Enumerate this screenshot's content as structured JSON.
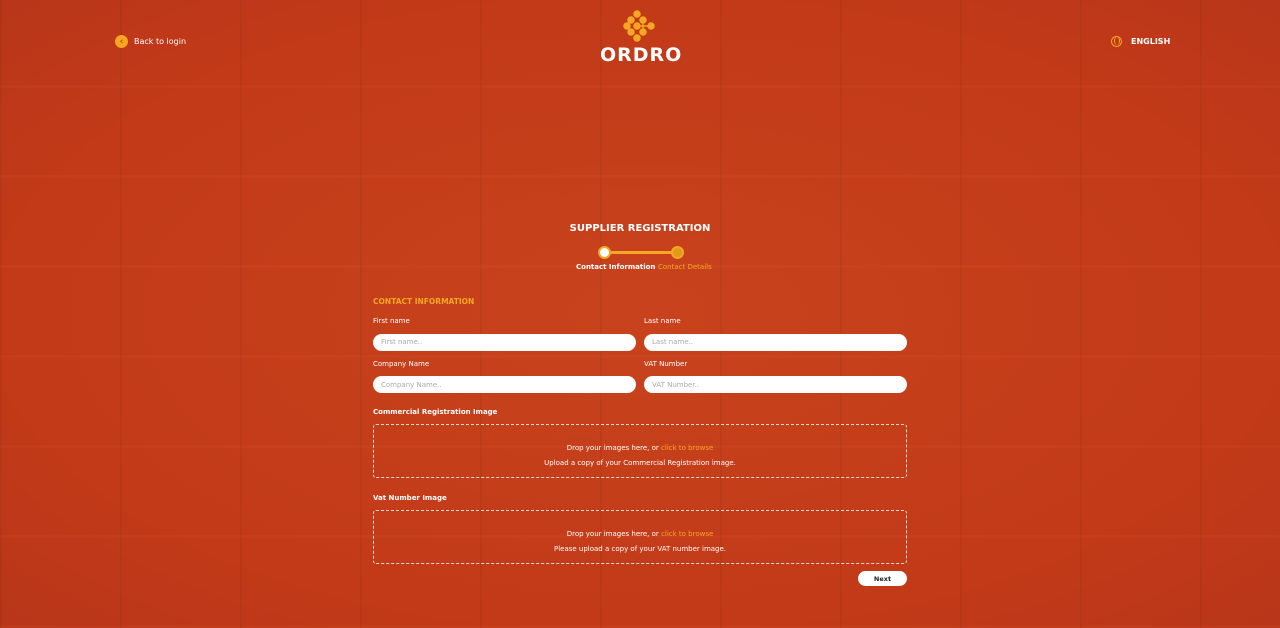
{
  "header": {
    "back_label": "Back to login",
    "language": "ENGLISH",
    "logo_text": "ORDRO"
  },
  "page": {
    "title": "SUPPLIER REGISTRATION",
    "steps": [
      {
        "label": "Contact Information",
        "active": true
      },
      {
        "label": "Contact Details",
        "active": false
      }
    ]
  },
  "form": {
    "section": "CONTACT INFORMATION",
    "first_name": {
      "label": "First name",
      "placeholder": "First name..",
      "value": ""
    },
    "last_name": {
      "label": "Last name",
      "placeholder": "Last name..",
      "value": ""
    },
    "company": {
      "label": "Company Name",
      "placeholder": "Company Name..",
      "value": ""
    },
    "vat": {
      "label": "VAT Number",
      "placeholder": "VAT Number..",
      "value": ""
    },
    "cr_upload": {
      "label": "Commercial Registration Image",
      "drop_text": "Drop your images here, or",
      "link": "click to browse",
      "hint": "Upload a copy of your Commercial Registration image."
    },
    "vat_upload": {
      "label": "Vat Number Image",
      "drop_text": "Drop your images here, or",
      "link": "click to browse",
      "hint": "Please upload a copy of your VAT number image."
    },
    "next_label": "Next"
  },
  "colors": {
    "background": "#c63d1a",
    "accent": "#f5a623"
  }
}
